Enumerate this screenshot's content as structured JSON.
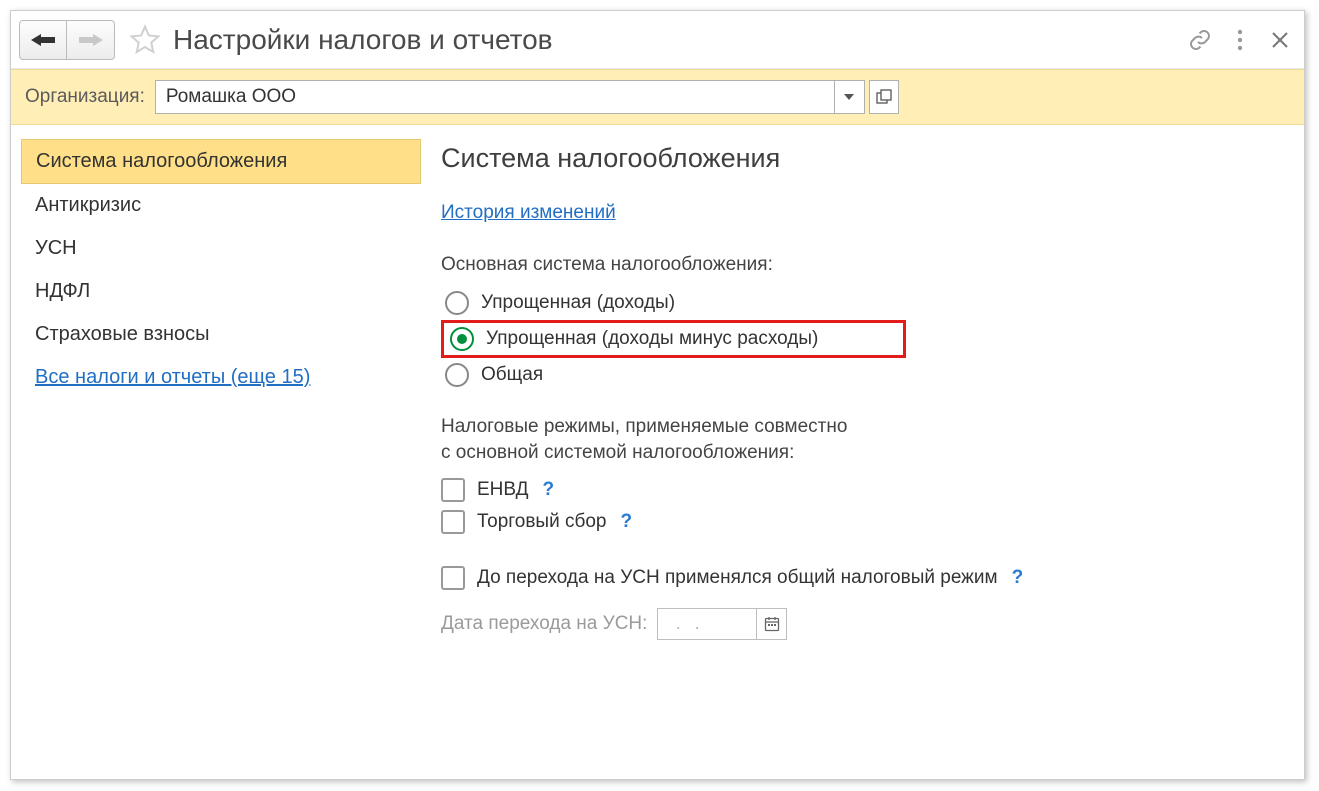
{
  "titlebar": {
    "title": "Настройки налогов и отчетов"
  },
  "orgbar": {
    "label": "Организация:",
    "value": "Ромашка ООО"
  },
  "sidebar": {
    "items": [
      "Система налогообложения",
      "Антикризис",
      "УСН",
      "НДФЛ",
      "Страховые взносы"
    ],
    "all_link": "Все налоги и отчеты (еще 15)"
  },
  "content": {
    "heading": "Система налогообложения",
    "history_link": "История изменений",
    "main_system_label": "Основная система налогообложения:",
    "radios": {
      "r1": "Упрощенная (доходы)",
      "r2": "Упрощенная (доходы минус расходы)",
      "r3": "Общая"
    },
    "modes_label1": "Налоговые режимы, применяемые совместно",
    "modes_label2": "с основной системой налогообложения:",
    "chk_envd": "ЕНВД",
    "chk_torg": "Торговый сбор",
    "chk_prior": "До перехода на УСН применялся общий налоговый режим",
    "date_label": "Дата перехода на УСН:",
    "date_placeholder": "  .   .",
    "help": "?"
  }
}
